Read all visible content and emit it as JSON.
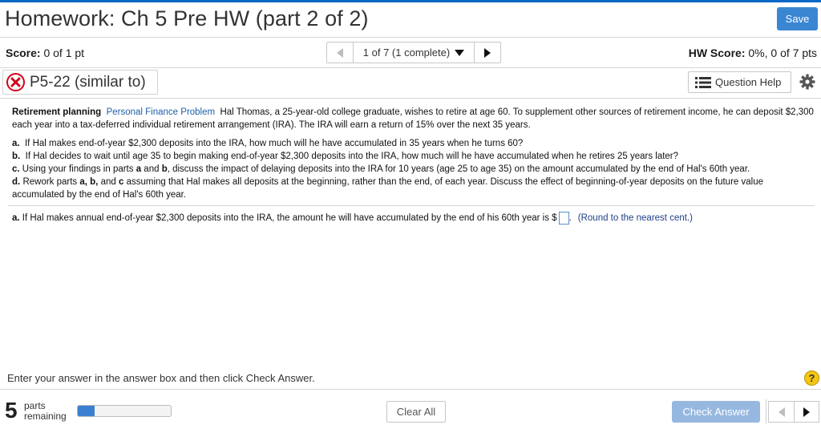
{
  "header": {
    "title": "Homework: Ch 5 Pre HW (part 2 of 2)",
    "save_label": "Save"
  },
  "score_bar": {
    "score_label": "Score:",
    "score_value": "0 of 1 pt",
    "nav_position": "1 of 7 (1 complete)",
    "hw_score_label": "HW Score:",
    "hw_score_value": "0%, 0 of 7 pts"
  },
  "question": {
    "id_label": "P5-22 (similar to)",
    "help_label": "Question Help",
    "topic": "Retirement planning",
    "category": "Personal Finance Problem",
    "intro": "Hal Thomas, a 25-year-old college graduate, wishes to retire at age 60.  To supplement other sources of retirement income, he can deposit $2,300 each year into a tax-deferred individual retirement arrangement (IRA).  The IRA will earn a return of 15% over the next 35 years.",
    "parts": [
      {
        "letter": "a.",
        "text": "If Hal makes end-of-year $2,300 deposits into the IRA, how much will he have accumulated in 35 years when he turns  60?"
      },
      {
        "letter": "b.",
        "text": "If Hal decides to wait until age 35 to begin making end-of-year $2,300 deposits into the IRA, how much will he have accumulated when he retires 25 years later?"
      },
      {
        "letter": "c.",
        "text_pre": "Using your findings in parts ",
        "bold1": "a",
        "mid": " and ",
        "bold2": "b",
        "text_post": ", discuss the impact of delaying deposits into the IRA for 10 years (age 25 to age 35) on the amount accumulated by the end of Hal's 60th year."
      },
      {
        "letter": "d.",
        "text_pre": "Rework parts ",
        "bold1": "a, b,",
        "mid": " and ",
        "bold2": "c",
        "text_post": " assuming that Hal makes all deposits at the beginning, rather than the end, of each year.  Discuss the effect of beginning-of-year deposits on the future value accumulated by the end of Hal's 60th year."
      }
    ],
    "answer_prompt_letter": "a.",
    "answer_prompt": "If Hal makes annual end-of-year $2,300 deposits into the IRA, the amount he will have accumulated by the end of his 60th year is $",
    "answer_value": "",
    "answer_suffix": ".",
    "round_note": "(Round to the nearest cent.)"
  },
  "footer": {
    "enter_note": "Enter your answer in the answer box and then click Check Answer.",
    "help_symbol": "?",
    "parts_remaining_count": "5",
    "parts_word": "parts",
    "remaining_word": "remaining",
    "progress_fraction": 0.18,
    "clear_all_label": "Clear All",
    "check_answer_label": "Check Answer"
  },
  "colors": {
    "accent": "#0a68c6",
    "save_button": "#3a86d3",
    "incorrect": "#d0021b",
    "link_blue": "#1f5ea8",
    "check_answer_disabled": "#96b8e0",
    "help_yellow": "#f3c614"
  }
}
